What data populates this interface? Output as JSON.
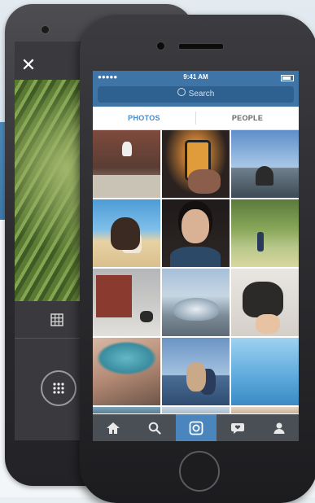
{
  "status_bar": {
    "signal": "●●●●● ",
    "time": "9:41 AM"
  },
  "search": {
    "placeholder": "Search"
  },
  "tabs": [
    {
      "label": "PHOTOS",
      "active": true
    },
    {
      "label": "PEOPLE",
      "active": false
    }
  ],
  "android": {
    "close_symbol": "✕"
  },
  "colors": {
    "brand_blue": "#3f74a6",
    "active_tab": "#4a8ac4",
    "tabbar": "#4a4f55",
    "tabbar_active": "#4a86bd"
  },
  "bottom_nav": [
    "home-icon",
    "search-icon",
    "camera-icon",
    "activity-icon",
    "profile-icon"
  ]
}
